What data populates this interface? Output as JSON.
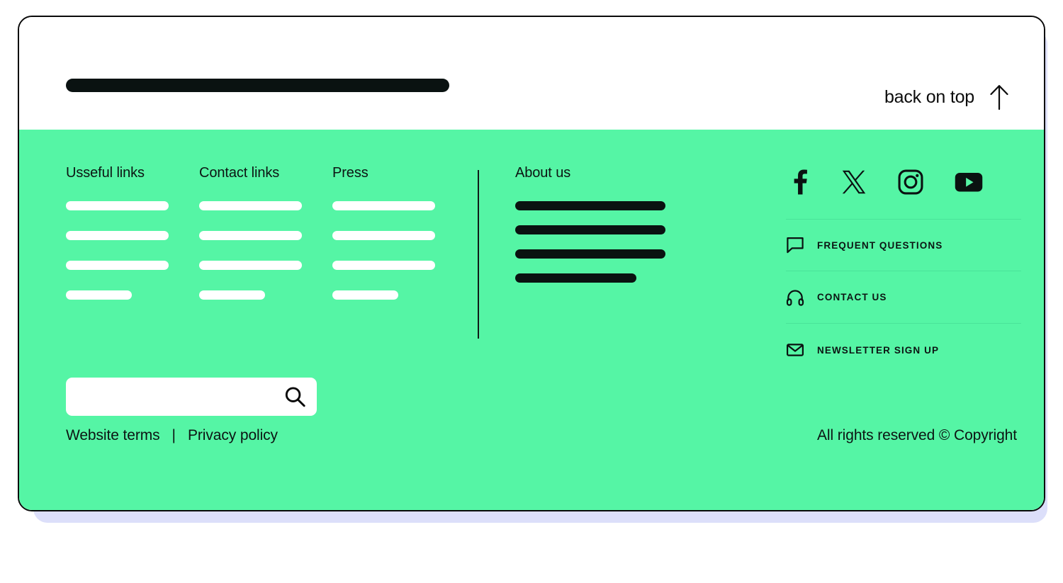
{
  "theme": {
    "accent_green": "#55F5A5",
    "ink": "#0C1513",
    "shadow_lavender": "#DCDFFA",
    "surface_white": "#FFFFFF"
  },
  "header": {
    "logo_placeholder": "",
    "back_to_top_label": "back on top",
    "back_to_top_icon": "arrow-up-icon"
  },
  "link_columns": [
    {
      "title": "Usseful links",
      "items": [
        {
          "label": "",
          "width": "full"
        },
        {
          "label": "",
          "width": "full"
        },
        {
          "label": "",
          "width": "full"
        },
        {
          "label": "",
          "width": "short"
        }
      ]
    },
    {
      "title": "Contact links",
      "items": [
        {
          "label": "",
          "width": "full"
        },
        {
          "label": "",
          "width": "full"
        },
        {
          "label": "",
          "width": "full"
        },
        {
          "label": "",
          "width": "short"
        }
      ]
    },
    {
      "title": "Press",
      "items": [
        {
          "label": "",
          "width": "full"
        },
        {
          "label": "",
          "width": "full"
        },
        {
          "label": "",
          "width": "full"
        },
        {
          "label": "",
          "width": "short"
        }
      ]
    }
  ],
  "about": {
    "title": "About us",
    "items": [
      {
        "label": "",
        "width": "full"
      },
      {
        "label": "",
        "width": "full"
      },
      {
        "label": "",
        "width": "full"
      },
      {
        "label": "",
        "width": "short"
      }
    ]
  },
  "socials": [
    {
      "name": "facebook-icon",
      "label": "Facebook"
    },
    {
      "name": "x-twitter-icon",
      "label": "X"
    },
    {
      "name": "instagram-icon",
      "label": "Instagram"
    },
    {
      "name": "youtube-icon",
      "label": "YouTube"
    }
  ],
  "quick_links": [
    {
      "icon": "chat-bubble-icon",
      "label": "FREQUENT QUESTIONS"
    },
    {
      "icon": "headphones-icon",
      "label": "CONTACT US"
    },
    {
      "icon": "envelope-icon",
      "label": "NEWSLETTER SIGN UP"
    }
  ],
  "search": {
    "value": "",
    "placeholder": "",
    "icon": "search-icon"
  },
  "legal": {
    "terms_label": "Website terms",
    "separator": "|",
    "privacy_label": "Privacy policy",
    "copyright": "All rights reserved © Copyright"
  }
}
